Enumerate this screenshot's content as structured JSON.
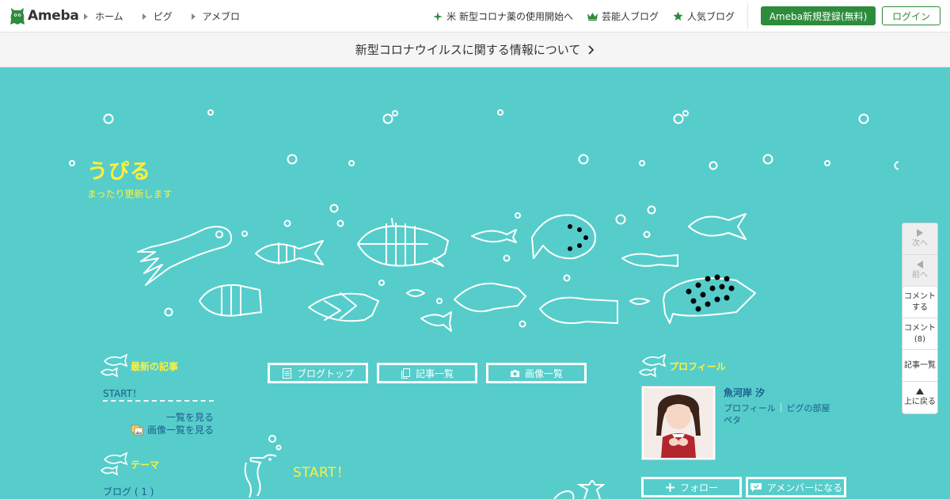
{
  "header": {
    "logo_text": "Ameba",
    "nav": [
      "ホーム",
      "ピグ",
      "アメブロ"
    ],
    "right_nav": [
      {
        "icon": "sparkle-icon",
        "label": "米 新型コロナ薬の使用開始へ"
      },
      {
        "icon": "crown-icon",
        "label": "芸能人ブログ"
      },
      {
        "icon": "star-icon",
        "label": "人気ブログ"
      }
    ],
    "register_label": "Ameba新規登録(無料)",
    "login_label": "ログイン"
  },
  "notice": {
    "text": "新型コロナウイルスに関する情報について"
  },
  "blog": {
    "title": "うぴる",
    "description": "まったり更新します"
  },
  "sidebar_left": {
    "latest_heading": "最新の記事",
    "latest_items": [
      "START！"
    ],
    "list_link": "一覧を見る",
    "image_list_link": "画像一覧を見る",
    "theme_heading": "テーマ",
    "themes": [
      "ブログ ( 1 )"
    ]
  },
  "center": {
    "buttons": [
      {
        "icon": "document-icon",
        "label": "ブログトップ"
      },
      {
        "icon": "copy-icon",
        "label": "記事一覧"
      },
      {
        "icon": "camera-icon",
        "label": "画像一覧"
      }
    ],
    "post_title": "START！"
  },
  "profile": {
    "heading": "プロフィール",
    "name": "魚河岸 汐",
    "links": [
      "プロフィール",
      "ピグの部屋"
    ],
    "peta": "ペタ",
    "follow_label": "フォロー",
    "member_label": "アメンバーになる"
  },
  "side_nav": [
    {
      "line1": "次へ",
      "line2": "",
      "disabled": true
    },
    {
      "line1": "前へ",
      "line2": "",
      "disabled": true
    },
    {
      "line1": "コメント",
      "line2": "する",
      "disabled": false
    },
    {
      "line1": "コメント",
      "line2": "(8)",
      "disabled": false
    },
    {
      "line1": "記事一覧",
      "line2": "",
      "disabled": false
    },
    {
      "line1": "上に戻る",
      "line2": "",
      "disabled": false
    }
  ],
  "colors": {
    "background": "#56cdcb",
    "accent_yellow": "#ffef3a",
    "link_blue": "#1b5d8a",
    "brand_green": "#2d8c3c"
  }
}
